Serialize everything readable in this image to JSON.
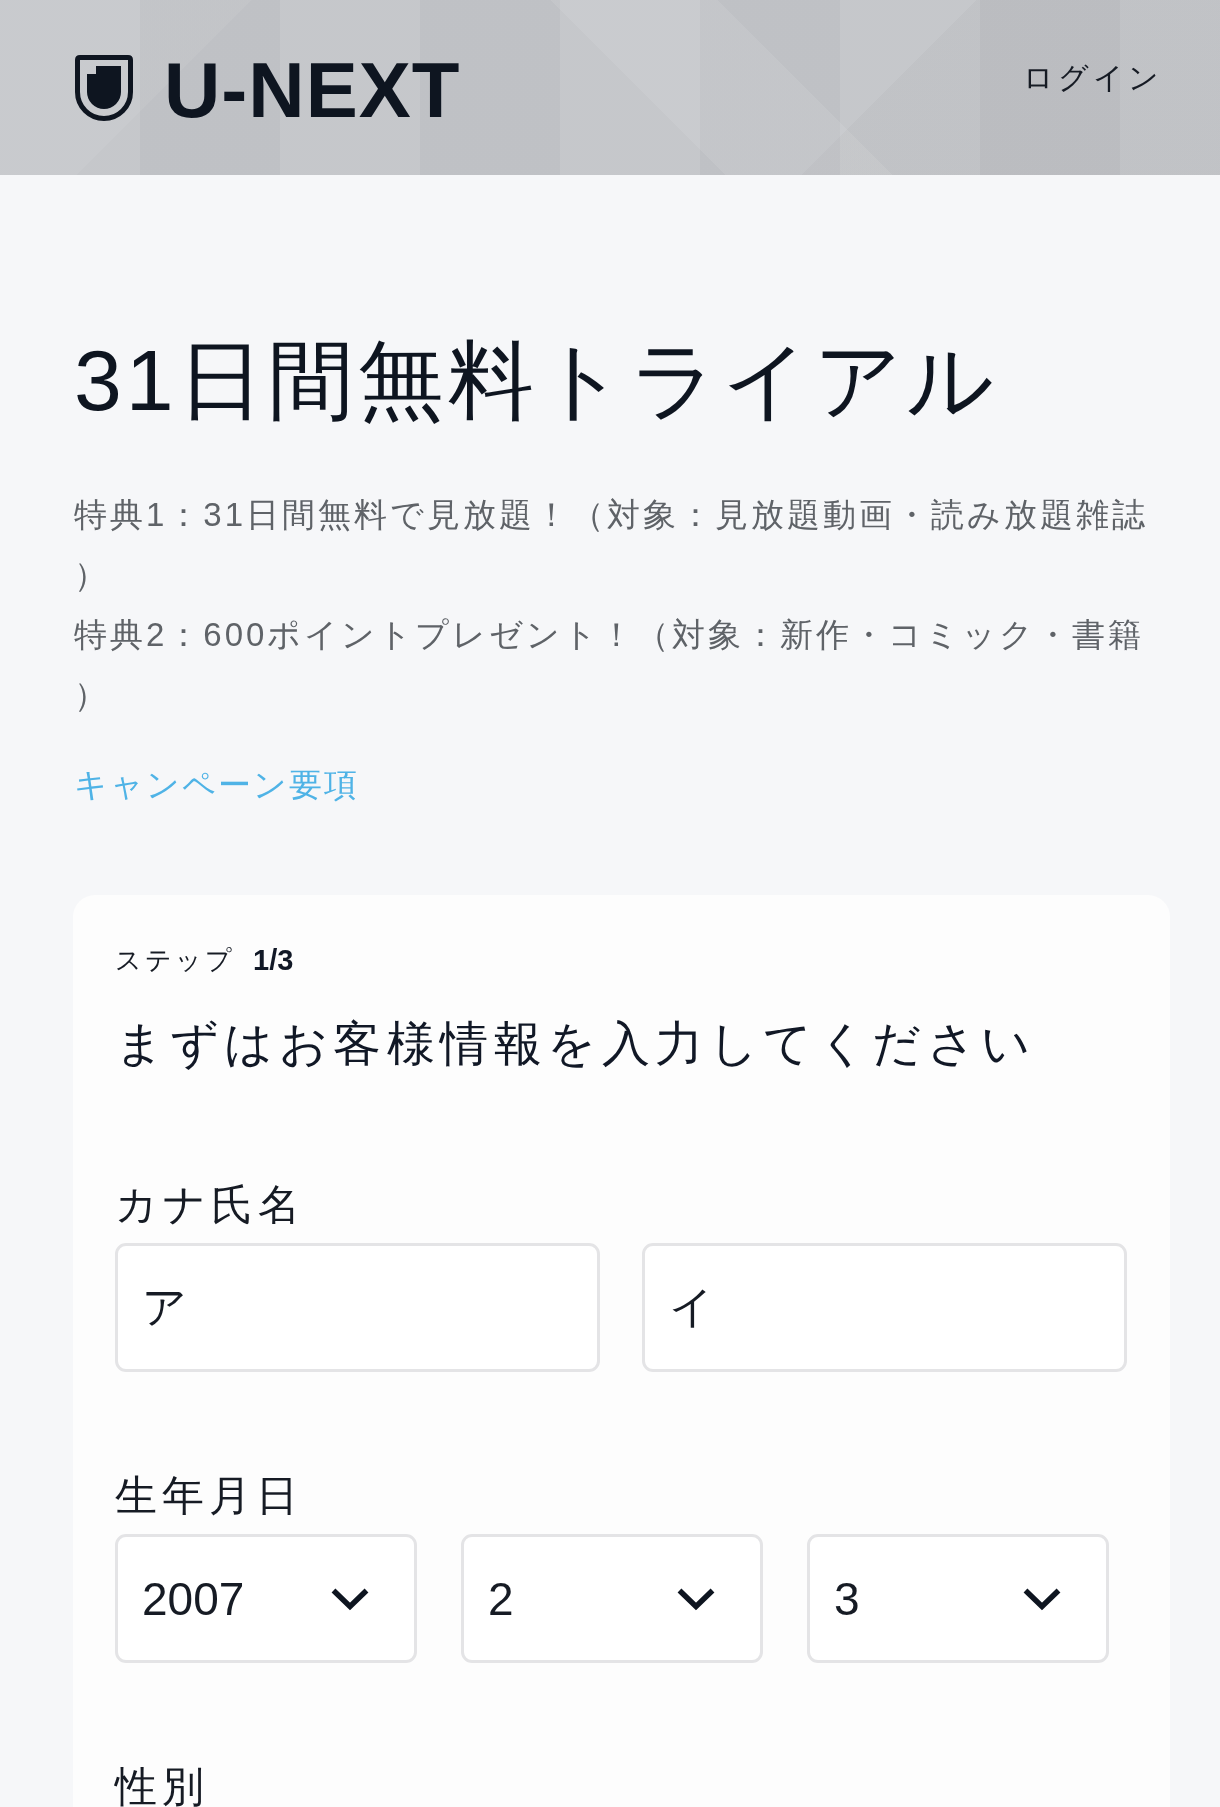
{
  "header": {
    "logo": "U-NEXT",
    "login": "ログイン"
  },
  "hero": {
    "title": "31日間無料トライアル",
    "perks": [
      "特典1：31日間無料で見放題！（対象：見放題動画・読み放題雑誌）",
      "特典2：600ポイントプレゼント！（対象：新作・コミック・書籍）"
    ],
    "link": "キャンペーン要項"
  },
  "form": {
    "step_label": "ステップ",
    "step": "1/3",
    "heading": "まずはお客様情報を入力してください",
    "fields": [
      {
        "label": "カナ氏名",
        "controls": [
          {
            "kind": "text",
            "value": "ア"
          },
          {
            "kind": "text",
            "value": "イ"
          }
        ]
      },
      {
        "label": "生年月日",
        "controls": [
          {
            "kind": "select",
            "value": "2007"
          },
          {
            "kind": "select",
            "value": "2"
          },
          {
            "kind": "select",
            "value": "3"
          }
        ]
      },
      {
        "label": "性別"
      }
    ]
  }
}
